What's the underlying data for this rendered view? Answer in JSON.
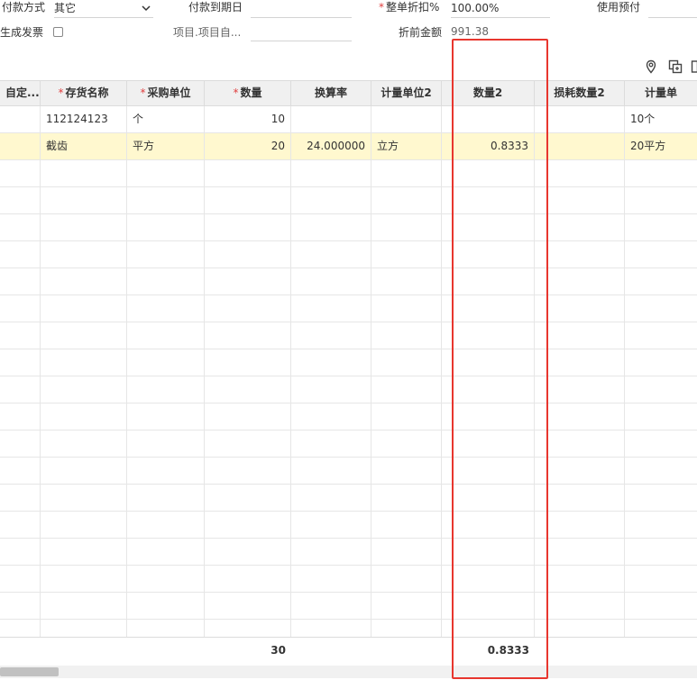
{
  "form": {
    "payment_method": {
      "label": "付款方式",
      "value": "其它"
    },
    "payment_due": {
      "label": "付款到期日",
      "value": ""
    },
    "discount": {
      "required_mark": "*",
      "label": "整单折扣%",
      "value": "100.00%"
    },
    "use_prepay": {
      "label": "使用预付",
      "value": ""
    },
    "gen_invoice": {
      "label": "生成发票",
      "checked": false
    },
    "project": {
      "label": "项目.项目自...",
      "value": ""
    },
    "pre_discount_amount": {
      "label": "折前金额",
      "value": "991.38"
    }
  },
  "toolbar": {
    "icons": [
      "location-pin-icon",
      "copy-icon",
      "more-icon"
    ]
  },
  "grid": {
    "columns": [
      {
        "key": "custom",
        "label": "自定...",
        "required": false
      },
      {
        "key": "name",
        "label": "存货名称",
        "required": true
      },
      {
        "key": "purchase_unit",
        "label": "采购单位",
        "required": true
      },
      {
        "key": "qty",
        "label": "数量",
        "required": true
      },
      {
        "key": "rate",
        "label": "换算率",
        "required": false
      },
      {
        "key": "unit2",
        "label": "计量单位2",
        "required": false
      },
      {
        "key": "qty2",
        "label": "数量2",
        "required": false
      },
      {
        "key": "loss_qty2",
        "label": "损耗数量2",
        "required": false
      },
      {
        "key": "unit_more",
        "label": "计量单",
        "required": false
      }
    ],
    "rows": [
      {
        "custom": "",
        "name": "112124123",
        "purchase_unit": "个",
        "qty": "10",
        "rate": "",
        "unit2": "",
        "qty2": "",
        "loss_qty2": "",
        "unit_more": "10个",
        "selected": false
      },
      {
        "custom": "",
        "name": "截齿",
        "purchase_unit": "平方",
        "qty": "20",
        "rate": "24.000000",
        "unit2": "立方",
        "qty2": "0.8333",
        "loss_qty2": "",
        "unit_more": "20平方",
        "selected": true
      }
    ],
    "footer": {
      "qty_total": "30",
      "qty2_total": "0.8333"
    }
  },
  "colors": {
    "highlight": "#e8362e",
    "selected_row": "#fff8cf",
    "required_mark": "#e04040",
    "header_bg": "#f0f0f0"
  }
}
